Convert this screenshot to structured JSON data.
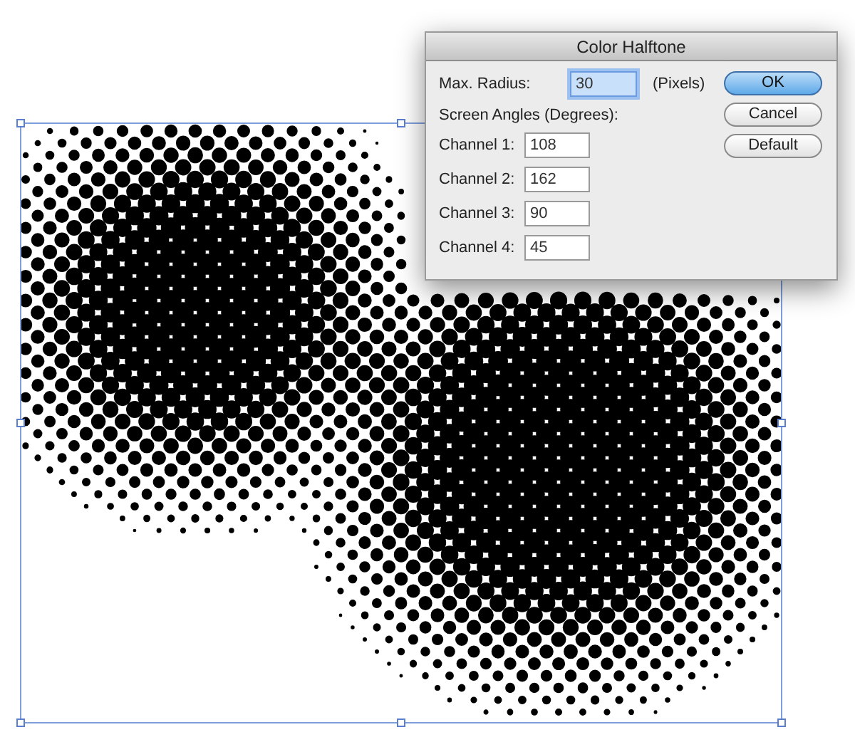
{
  "dialog": {
    "title": "Color Halftone",
    "max_radius": {
      "label": "Max. Radius:",
      "value": "30",
      "unit": "(Pixels)",
      "focused": true
    },
    "screen_angles_label": "Screen Angles (Degrees):",
    "channels": [
      {
        "label": "Channel 1:",
        "value": "108"
      },
      {
        "label": "Channel 2:",
        "value": "162"
      },
      {
        "label": "Channel 3:",
        "value": "90"
      },
      {
        "label": "Channel 4:",
        "value": "45"
      }
    ],
    "buttons": [
      {
        "label": "OK",
        "default": true
      },
      {
        "label": "Cancel",
        "default": false
      },
      {
        "label": "Default",
        "default": false
      }
    ]
  }
}
